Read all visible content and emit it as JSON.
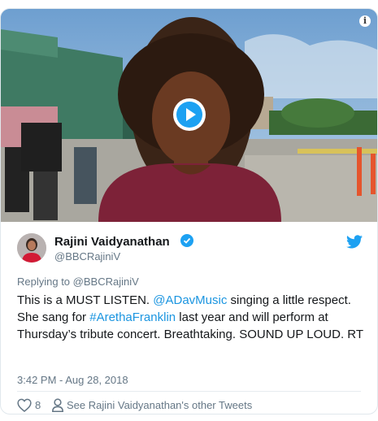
{
  "media": {
    "icons": {
      "info": "info-icon",
      "play": "play-icon"
    },
    "info_glyph": "i"
  },
  "author": {
    "name": "Rajini Vaidyanathan",
    "handle": "@BBCRajiniV",
    "verified": true,
    "icons": {
      "avatar": "avatar",
      "verified": "verified-badge-icon",
      "brand": "twitter-bird-icon"
    }
  },
  "tweet": {
    "replying_to": "Replying to @BBCRajiniV",
    "segments": [
      {
        "type": "text",
        "value": "This is a MUST LISTEN. "
      },
      {
        "type": "mention",
        "value": "@ADavMusic"
      },
      {
        "type": "text",
        "value": " singing a little respect. She sang for "
      },
      {
        "type": "hashtag",
        "value": "#ArethaFranklin"
      },
      {
        "type": "text",
        "value": " last year and will perform at Thursday’s tribute concert. Breathtaking. SOUND UP LOUD. RT"
      }
    ],
    "timestamp": "3:42 PM - Aug 28, 2018"
  },
  "actions": {
    "like_count": "8",
    "other_tweets": "See Rajini Vaidyanathan's other Tweets",
    "icons": {
      "like": "heart-icon",
      "profile": "person-icon"
    }
  },
  "colors": {
    "link": "#1b95e0",
    "brand": "#1da1f2",
    "text": "#14171a",
    "secondary": "#657786"
  }
}
